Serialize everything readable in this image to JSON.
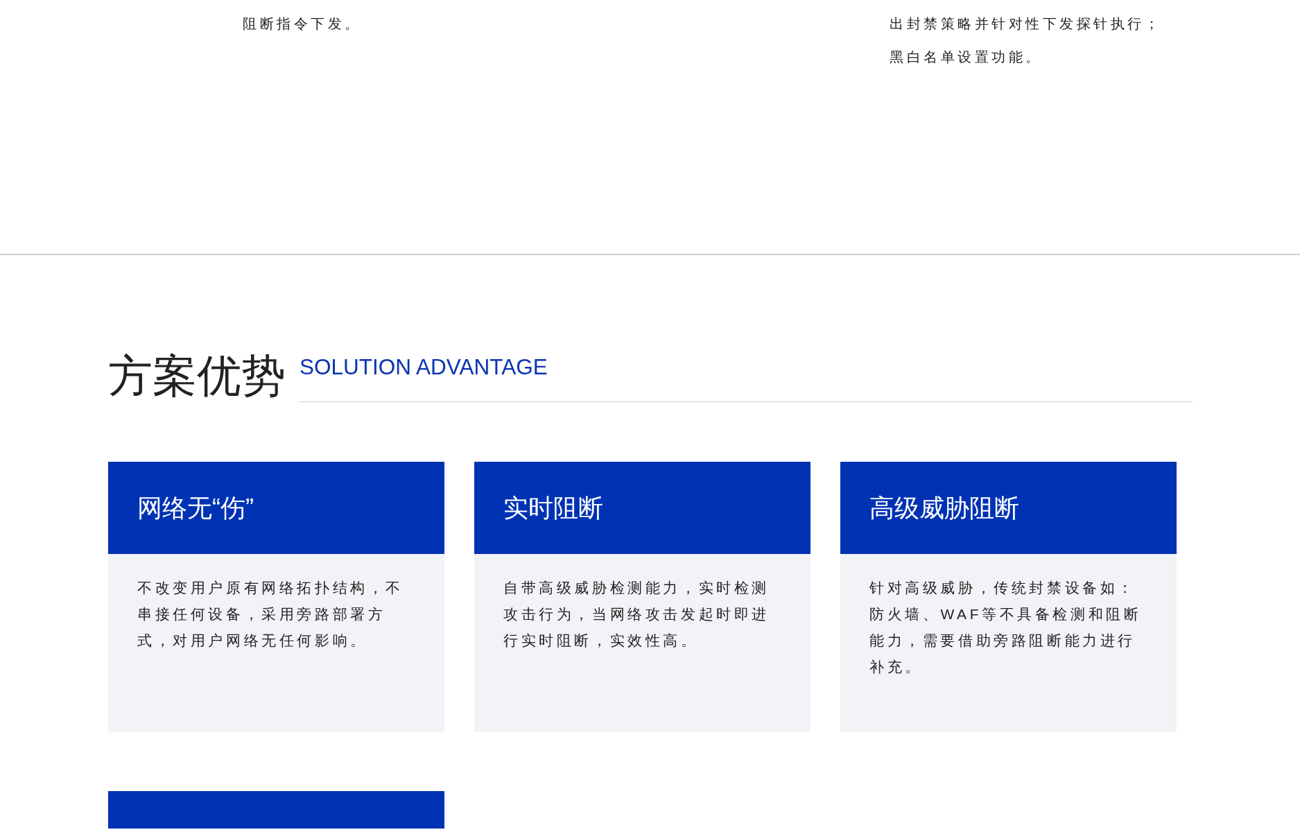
{
  "top_fragments": [
    {
      "lines": [
        "阻断指令下发。"
      ]
    },
    {
      "lines": [
        "出封禁策略并针对性下发探针执行；",
        "黑白名单设置功能。"
      ]
    }
  ],
  "section": {
    "title": "方案优势",
    "subtitle": "SOLUTION ADVANTAGE"
  },
  "cards": [
    {
      "kind": "full",
      "title": "网络无“伤”",
      "text": "不改变用户原有网络拓扑结构，不串接任何设备，采用旁路部署方式，对用户网络无任何影响。"
    },
    {
      "kind": "full",
      "title": "实时阻断",
      "text": "自带高级威胁检测能力，实时检测攻击行为，当网络攻击发起时即进行实时阻断，实效性高。"
    },
    {
      "kind": "full",
      "title": "高级威胁阻断",
      "text": "针对高级威胁，传统封禁设备如：防火墙、WAF等不具备检测和阻断能力，需要借助旁路阻断能力进行补充。"
    },
    {
      "kind": "partial"
    }
  ]
}
